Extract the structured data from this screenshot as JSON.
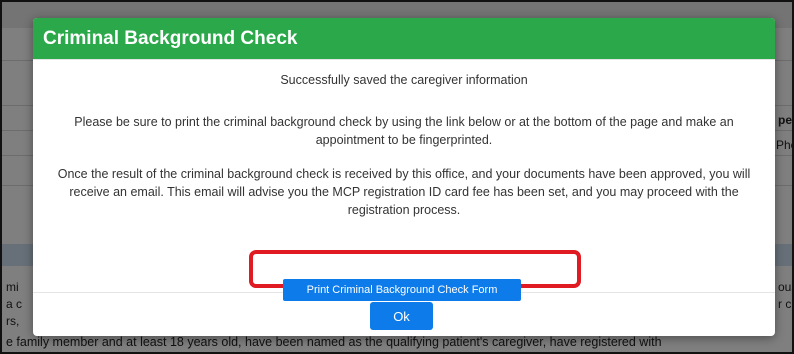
{
  "background": {
    "snippets": {
      "right_header": "pe",
      "right_cell": "Phe",
      "left_line_1": "mi",
      "left_line_2": "a c",
      "left_line_3": "rs,",
      "right_line_1": "ous",
      "right_line_2": "r c",
      "bottom_line": "e family member and at least 18 years old, have been named as the qualifying patient's caregiver, have registered with"
    }
  },
  "modal": {
    "title": "Criminal Background Check",
    "success_message": "Successfully saved the caregiver information",
    "print_instructions": "Please be sure to print the criminal background check by using the link below or at the bottom of the page and make an appointment to be fingerprinted.",
    "result_message": "Once the result of the criminal background check is received by this office, and your documents have been approved, you will receive an email. This email will advise you the MCP registration ID card fee has been set, and you may proceed with the registration process.",
    "print_button_label": "Print Criminal Background Check Form",
    "ok_button_label": "Ok",
    "colors": {
      "header": "#2aa84a",
      "button": "#0d7bea",
      "highlight": "#e01b22"
    }
  }
}
